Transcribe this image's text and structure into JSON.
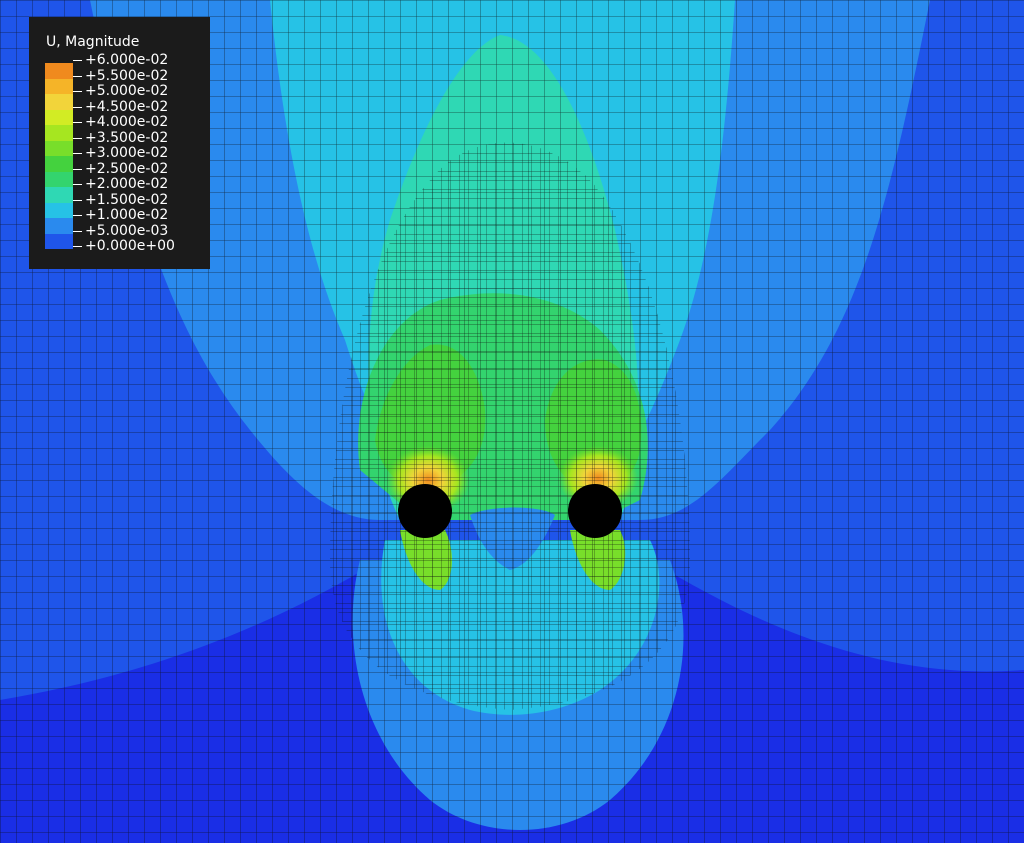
{
  "legend": {
    "title": "U, Magnitude",
    "labels": [
      "+6.000e-02",
      "+5.500e-02",
      "+5.000e-02",
      "+4.500e-02",
      "+4.000e-02",
      "+3.500e-02",
      "+3.000e-02",
      "+2.500e-02",
      "+2.000e-02",
      "+1.500e-02",
      "+1.000e-02",
      "+5.000e-03",
      "+0.000e+00"
    ],
    "colors": [
      "#f08a1e",
      "#f5b428",
      "#f2d43a",
      "#d2ec24",
      "#a6e620",
      "#78de2a",
      "#44d23e",
      "#33d46e",
      "#2fd8b4",
      "#26c2e6",
      "#2a8aee",
      "#1f55ea"
    ]
  },
  "holes": {
    "count": 2,
    "color": "#000000"
  },
  "mesh": {
    "line_color": "#0a0a0a"
  }
}
